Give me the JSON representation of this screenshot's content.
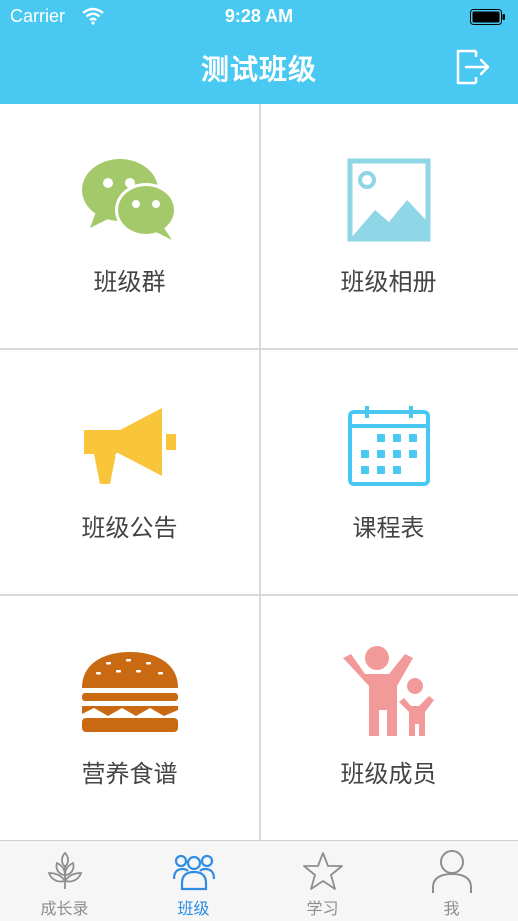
{
  "status": {
    "carrier": "Carrier",
    "time": "9:28 AM"
  },
  "nav": {
    "title": "测试班级"
  },
  "grid": [
    {
      "label": "班级群",
      "icon": "wechat-icon",
      "color": "#A3C96A"
    },
    {
      "label": "班级相册",
      "icon": "photo-album-icon",
      "color": "#8FD6E6"
    },
    {
      "label": "班级公告",
      "icon": "megaphone-icon",
      "color": "#F8C53B"
    },
    {
      "label": "课程表",
      "icon": "calendar-icon",
      "color": "#49C9F2"
    },
    {
      "label": "营养食谱",
      "icon": "burger-icon",
      "color": "#C96A12"
    },
    {
      "label": "班级成员",
      "icon": "family-icon",
      "color": "#F29A9A"
    }
  ],
  "tabs": [
    {
      "label": "成长录",
      "icon": "tree-icon",
      "active": false
    },
    {
      "label": "班级",
      "icon": "group-icon",
      "active": true
    },
    {
      "label": "学习",
      "icon": "star-icon",
      "active": false
    },
    {
      "label": "我",
      "icon": "user-icon",
      "active": false
    }
  ],
  "colors": {
    "nav_bg": "#49C9F2",
    "tab_active": "#2F8DE4",
    "tab_inactive": "#8E8E8E"
  }
}
